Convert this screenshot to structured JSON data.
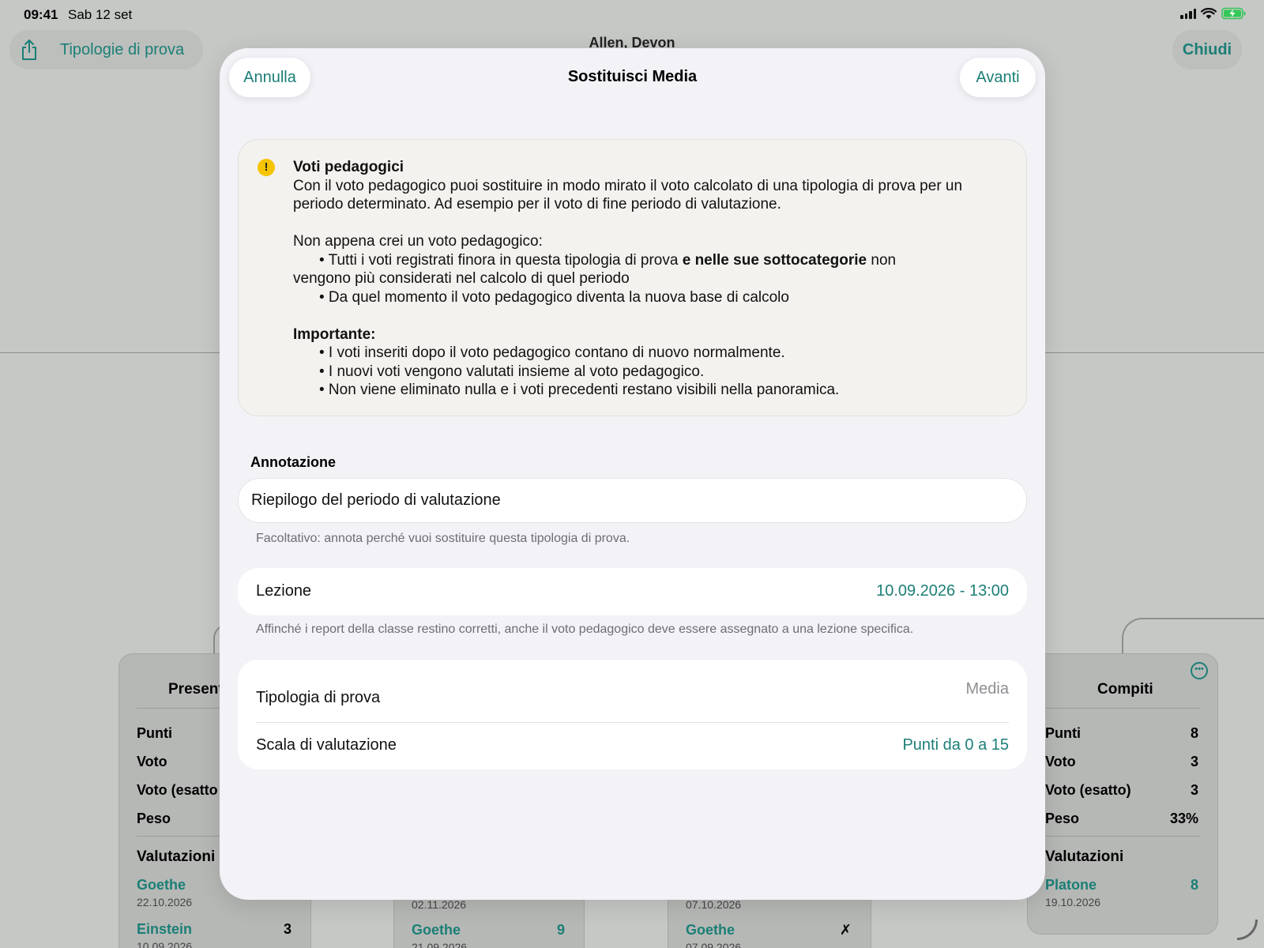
{
  "status_bar": {
    "time": "09:41",
    "date": "Sab 12 set"
  },
  "background": {
    "share_label": "Tipologie di prova",
    "student_name": "Allen, Devon",
    "close_label": "Chiudi",
    "card_left": {
      "title": "Present",
      "rows": [
        "Punti",
        "Voto",
        "Voto (esatto",
        "Peso"
      ],
      "section": "Valutazioni",
      "entries": [
        {
          "name": "Goethe",
          "date": "22.10.2026",
          "value": ""
        },
        {
          "name": "Einstein",
          "date": "10.09.2026",
          "value": "3"
        }
      ]
    },
    "card_mid1": {
      "date_top": "02.11.2026",
      "entry_name": "Goethe",
      "entry_value": "9",
      "entry_date": "21.09.2026"
    },
    "card_mid2": {
      "date_top": "07.10.2026",
      "entry_name": "Goethe",
      "entry_value": "✗",
      "entry_date": "07.09.2026"
    },
    "card_right": {
      "title": "Compiti",
      "rows": [
        {
          "label": "Punti",
          "value": "8"
        },
        {
          "label": "Voto",
          "value": "3"
        },
        {
          "label": "Voto (esatto)",
          "value": "3"
        },
        {
          "label": "Peso",
          "value": "33%"
        }
      ],
      "section": "Valutazioni",
      "entry": {
        "name": "Platone",
        "value": "8",
        "date": "19.10.2026"
      }
    }
  },
  "sheet": {
    "title": "Sostituisci Media",
    "cancel_label": "Annulla",
    "next_label": "Avanti",
    "info": {
      "title": "Voti pedagogici",
      "paragraph": "Con il voto pedagogico puoi sostituire in modo mirato il voto calcolato di una tipologia di prova per un periodo determinato. Ad esempio per il voto di fine periodo di valutazione.",
      "intro": "Non appena crei un voto pedagogico:",
      "bullet1_a": "• Tutti i voti registrati finora in questa tipologia di prova ",
      "bullet1_bold": "e nelle sue sottocategorie",
      "bullet1_b": " non",
      "bullet1_c": "vengono più considerati nel calcolo di quel periodo",
      "bullet2": "• Da quel momento il voto pedagogico diventa la nuova base di calcolo",
      "important_title": "Importante:",
      "important_bullets": [
        "• I voti inseriti dopo il voto pedagogico contano di nuovo normalmente.",
        "• I nuovi voti vengono valutati insieme al voto pedagogico.",
        "• Non viene eliminato nulla e i voti precedenti restano visibili nella panoramica."
      ]
    },
    "annotation": {
      "label": "Annotazione",
      "value": "Riepilogo del periodo di valutazione",
      "hint": "Facoltativo: annota perché vuoi sostituire questa tipologia di prova."
    },
    "lesson": {
      "label": "Lezione",
      "value": "10.09.2026 - 13:00",
      "hint": "Affinché i report della classe restino corretti, anche il voto pedagogico deve essere assegnato a una lezione specifica."
    },
    "exam_type": {
      "label": "Tipologia di prova",
      "value": "Media"
    },
    "scale": {
      "label": "Scala di valutazione",
      "value": "Punti da 0 a 15"
    }
  },
  "colors": {
    "accent": "#1b7f76",
    "warning": "#f6c400",
    "sheet_bg": "#f2f2f7"
  }
}
